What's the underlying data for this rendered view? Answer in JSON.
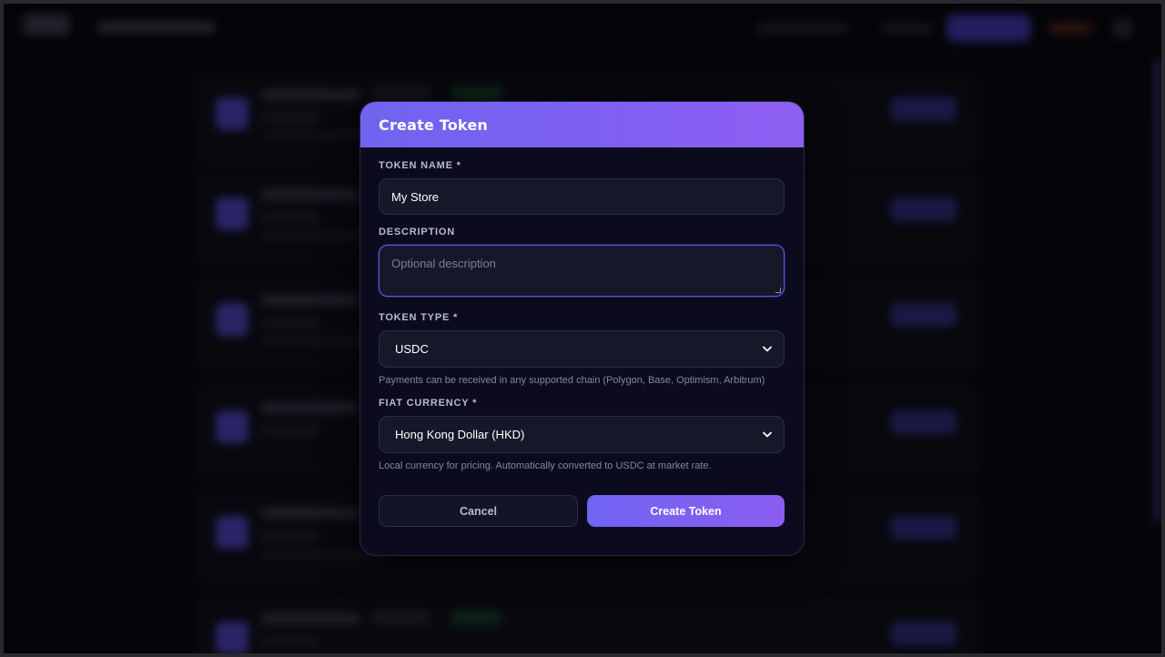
{
  "modal": {
    "title": "Create Token",
    "token_name": {
      "label": "TOKEN NAME *",
      "value": "My Store"
    },
    "description": {
      "label": "DESCRIPTION",
      "placeholder": "Optional description"
    },
    "token_type": {
      "label": "TOKEN TYPE *",
      "selected": "USDC",
      "hint": "Payments can be received in any supported chain (Polygon, Base, Optimism, Arbitrum)"
    },
    "fiat_currency": {
      "label": "FIAT CURRENCY *",
      "selected": "Hong Kong Dollar (HKD)",
      "hint": "Local currency for pricing. Automatically converted to USDC at market rate."
    },
    "buttons": {
      "cancel": "Cancel",
      "create": "Create Token"
    }
  },
  "colors": {
    "accent_start": "#6e64f0",
    "accent_end": "#8e5ef2",
    "modal_bg": "#0b0b1d",
    "field_bg": "#17172a",
    "focus_border": "#5b55e6"
  },
  "icons": {
    "select_chevron": "chevron-down-icon"
  }
}
